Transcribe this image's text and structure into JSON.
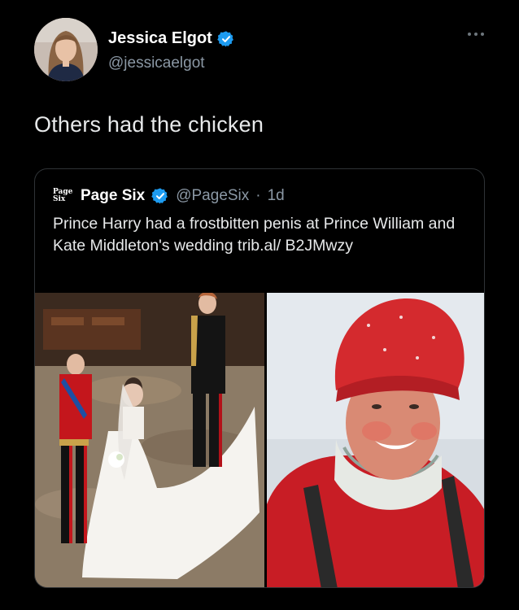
{
  "tweet": {
    "author_name": "Jessica Elgot",
    "author_handle": "@jessicaelgot",
    "text": "Others had the chicken",
    "accent_color": "#1d9bf0"
  },
  "quote": {
    "avatar_text": "Page Six",
    "author_name": "Page Six",
    "author_handle": "@PageSix",
    "separator": "·",
    "time": "1d",
    "text": "Prince Harry had a frostbitten penis at Prince William and Kate Middleton's wedding trib.al/ B2JMwzy"
  }
}
